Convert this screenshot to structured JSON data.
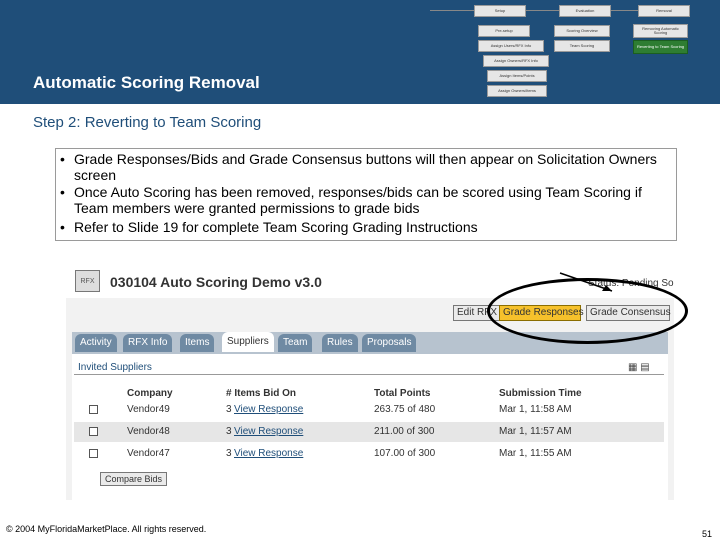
{
  "header": {
    "title": "Automatic Scoring  Removal",
    "flowchart": {
      "top": [
        "Setup",
        "Evaluation",
        "Removal"
      ],
      "row2": [
        "Pre-setup",
        "Scoring Overview",
        "Removing Automatic Scoring"
      ],
      "row3": [
        "Assign Users/RFX Info",
        "Team Scoring",
        "Reverting to Team Scoring"
      ],
      "row4": [
        "Assign Owners/RFX Info"
      ],
      "row5": [
        "Assign Items/Points"
      ],
      "row6": [
        "Assign Owners/Items"
      ]
    }
  },
  "step_heading": "Step 2: Reverting to Team Scoring",
  "bullets": [
    "Grade Responses/Bids  and Grade Consensus buttons will then appear on Solicitation Owners screen",
    "Once Auto Scoring has been removed, responses/bids can be scored using Team Scoring if Team members were granted permissions to grade bids",
    "Refer to Slide  19 for complete Team Scoring Grading Instructions"
  ],
  "screenshot": {
    "logo": "RFX",
    "title": "030104 Auto Scoring Demo v3.0",
    "right_label": "Status: Pending Solicitation",
    "buttons": {
      "edit": "Edit RFX",
      "grade_responses": "Grade Responses",
      "grade_consensus": "Grade Consensus"
    },
    "tabs": [
      "Activity",
      "RFX Info",
      "Items",
      "Suppliers",
      "Team",
      "Rules",
      "Proposals"
    ],
    "active_tab": "Suppliers",
    "panel_title": "Invited Suppliers",
    "panel_icons": "▦ ▤",
    "columns": [
      "Company",
      "# Items Bid On",
      "Total Points",
      "Submission Time"
    ],
    "rows": [
      {
        "company": "Vendor49",
        "items": "3",
        "link": "View Response",
        "points": "263.75 of 480",
        "time": "Mar 1, 11:58 AM"
      },
      {
        "company": "Vendor48",
        "items": "3",
        "link": "View Response",
        "points": "211.00 of 300",
        "time": "Mar 1, 11:57 AM"
      },
      {
        "company": "Vendor47",
        "items": "3",
        "link": "View Response",
        "points": "107.00 of 300",
        "time": "Mar 1, 11:55 AM"
      }
    ],
    "compare_button": "Compare Bids"
  },
  "footer": {
    "copyright": "© 2004 MyFloridaMarketPlace. All rights reserved.",
    "page_number": "51"
  },
  "colors": {
    "header_bg": "#1f4e79",
    "highlight": "#f6c12b",
    "tab_inactive": "#6f8aa3"
  }
}
